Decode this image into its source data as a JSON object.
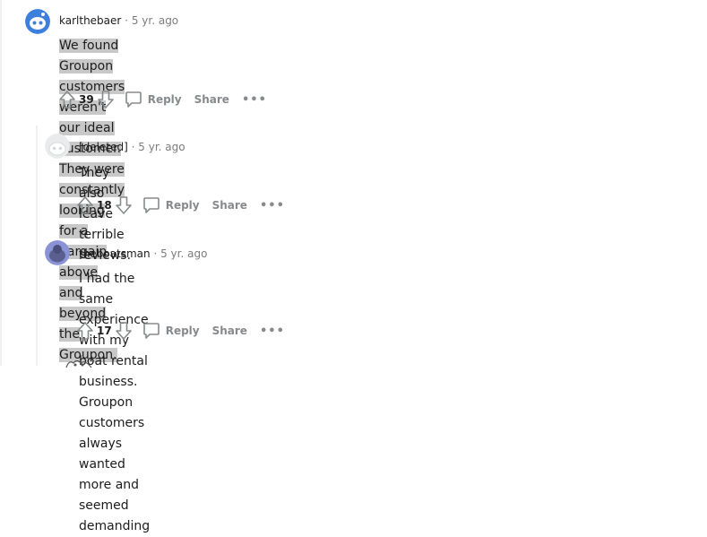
{
  "comments": [
    {
      "author": "karlthebaer",
      "separator": "·",
      "time": "5 yr. ago",
      "text_lines": [
        "We found Groupon customers weren't our ideal customer. They were constantly looking for a",
        "bargain above and beyond the Groupon."
      ],
      "score": "39",
      "reply_label": "Reply",
      "share_label": "Share",
      "more_label": "•••"
    },
    {
      "author": "[deleted]",
      "separator": "·",
      "time": "5 yr. ago",
      "text_lines": [
        "They also leave terrible reviews."
      ],
      "score": "18",
      "reply_label": "Reply",
      "share_label": "Share",
      "more_label": "•••"
    },
    {
      "author": "theboatsman",
      "separator": "·",
      "time": "5 yr. ago",
      "text_lines": [
        "I had the same experience with my boat rental business. Groupon customers always wanted",
        "more and seemed demanding"
      ],
      "score": "17",
      "reply_label": "Reply",
      "share_label": "Share",
      "more_label": "•••"
    }
  ],
  "colors": {
    "highlight": "#c8c8c8",
    "meta_gray": "#7c7c7c",
    "action_gray": "#878a8c",
    "avatar_blue": "#3d7fdc",
    "avatar_purple": "#6b6fa8"
  }
}
